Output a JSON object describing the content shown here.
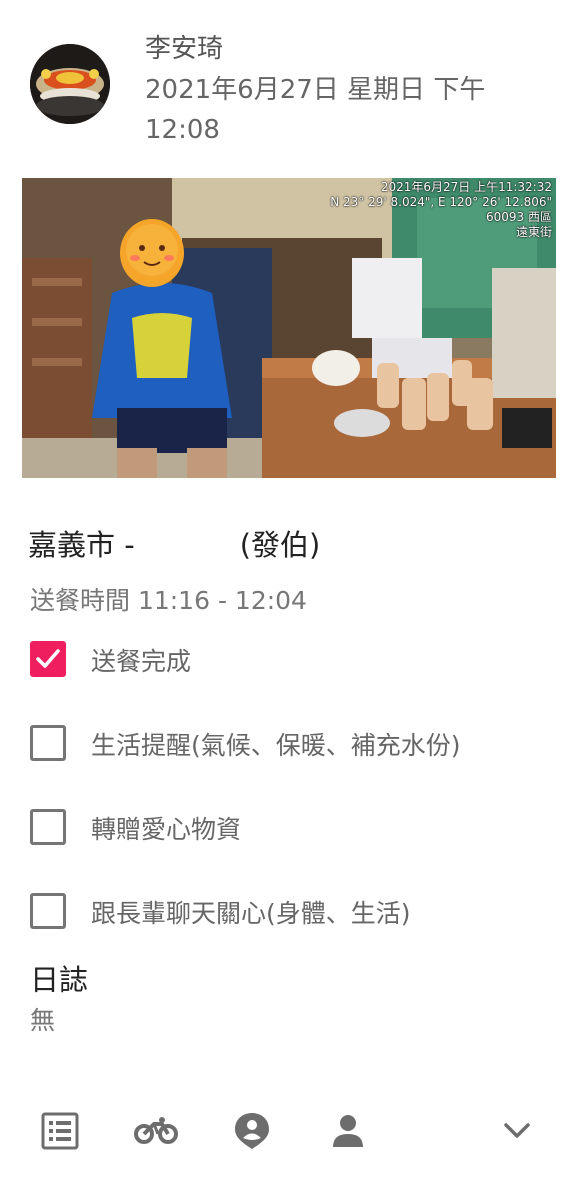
{
  "post": {
    "author": "李安琦",
    "datetime": "2021年6月27日 星期日 下午 12:08"
  },
  "photo": {
    "stamp_date": "2021年6月27日 上午11:32:32",
    "stamp_coords": "N 23° 29' 8.024\", E 120° 26' 12.806\"",
    "stamp_area": "60093 西區",
    "stamp_street": "遠東街"
  },
  "record": {
    "city_prefix": "嘉義市 -",
    "elder_name": "(發伯)",
    "delivery_time": "送餐時間 11:16 - 12:04"
  },
  "checklist": [
    {
      "label": "送餐完成",
      "checked": true
    },
    {
      "label": "生活提醒(氣候、保暖、補充水份)",
      "checked": false
    },
    {
      "label": "轉贈愛心物資",
      "checked": false
    },
    {
      "label": "跟長輩聊天關心(身體、生活)",
      "checked": false
    }
  ],
  "log": {
    "title": "日誌",
    "value": "無"
  },
  "nav": {
    "icons": [
      "list-icon",
      "bicycle-icon",
      "location-person-icon",
      "person-icon",
      "chevron-down-icon"
    ]
  },
  "colors": {
    "accent": "#ef1f5f",
    "icon_gray": "#6d6d6d"
  }
}
